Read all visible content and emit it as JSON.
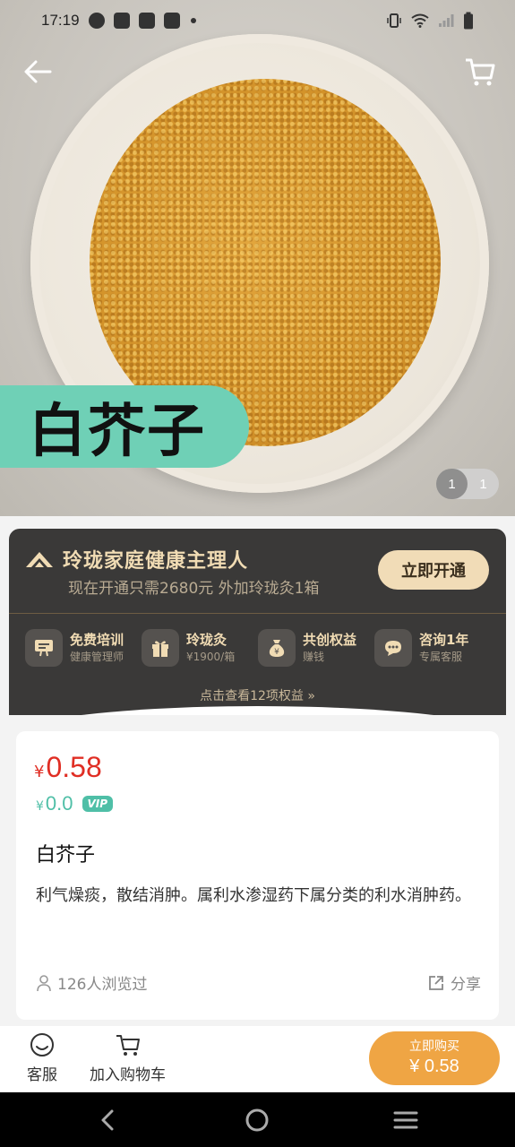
{
  "status_bar": {
    "time": "17:19"
  },
  "hero": {
    "product_name_overlay": "白芥子",
    "pager_current": "1",
    "pager_total": "1"
  },
  "membership": {
    "title": "玲珑家庭健康主理人",
    "subtitle": "现在开通只需2680元 外加玲珑灸1箱",
    "open_button": "立即开通",
    "benefits": [
      {
        "title": "免费培训",
        "sub": "健康管理师",
        "icon": "screen-icon"
      },
      {
        "title": "玲珑灸",
        "sub": "¥1900/箱",
        "icon": "gift-icon"
      },
      {
        "title": "共创权益",
        "sub": "赚钱",
        "icon": "money-bag-icon"
      },
      {
        "title": "咨询1年",
        "sub": "专属客服",
        "icon": "chat-icon"
      }
    ],
    "more_link": "点击查看12项权益 »"
  },
  "product": {
    "currency": "¥",
    "price": "0.58",
    "vip_price": "0.0",
    "vip_badge": "VIP",
    "name": "白芥子",
    "description": "利气燥痰，散结消肿。属利水渗湿药下属分类的利水消肿药。",
    "views": "126人浏览过",
    "share": "分享"
  },
  "action_bar": {
    "service_label": "客服",
    "cart_label": "加入购物车",
    "buy_top": "立即购买",
    "buy_price": "¥ 0.58"
  },
  "colors": {
    "accent_orange": "#efa544",
    "price_red": "#e02e24",
    "vip_teal": "#4fbfa7",
    "member_gold": "#f1dcb4",
    "member_bg": "#3a3938"
  }
}
